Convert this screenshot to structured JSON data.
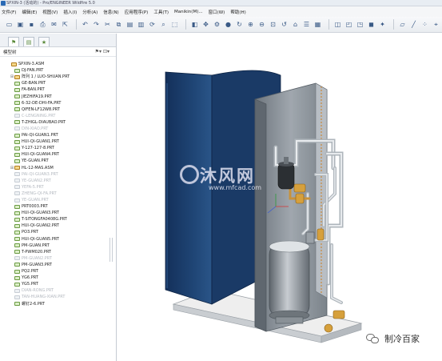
{
  "window": {
    "title": "SPXIN-3 (活动的) - Pro/ENGINEER Wildfire 5.0"
  },
  "menu": {
    "items": [
      "文件(F)",
      "编辑(E)",
      "视图(V)",
      "插入(I)",
      "分析(A)",
      "信息(N)",
      "应用程序(P)",
      "工具(T)",
      "Manikin(M)...",
      "窗口(W)",
      "帮助(H)"
    ]
  },
  "sidebar": {
    "tree_title": "模型树",
    "tree_controls": "⚑▾ ⊡▾",
    "items": [
      {
        "label": "SPXIN-3.ASM",
        "level": "root",
        "type": "asm",
        "dim": false,
        "exp": ""
      },
      {
        "label": "DJ-FAN.PRT",
        "level": "lvl1",
        "type": "prt",
        "dim": false,
        "exp": ""
      },
      {
        "label": "阵列 1 / LUO-SHUAN.PRT",
        "level": "lvl1",
        "type": "asm",
        "dim": false,
        "exp": "⊞"
      },
      {
        "label": "GE-BAN.PRT",
        "level": "lvl1",
        "type": "prt",
        "dim": false,
        "exp": ""
      },
      {
        "label": "FA-BAN.PRT",
        "level": "lvl1",
        "type": "prt",
        "dim": false,
        "exp": ""
      },
      {
        "label": "JIEZHIFA19.PRT",
        "level": "lvl1",
        "type": "prt",
        "dim": false,
        "exp": ""
      },
      {
        "label": "6-32-DE-DHI-FA.PRT",
        "level": "lvl1",
        "type": "prt",
        "dim": false,
        "exp": ""
      },
      {
        "label": "QIFEN-LF12W8.PRT",
        "level": "lvl1",
        "type": "prt",
        "dim": false,
        "exp": ""
      },
      {
        "label": "C-LENGNING.PRT",
        "level": "lvl1",
        "type": "prt",
        "dim": true,
        "exp": ""
      },
      {
        "label": "T-ZHIGL-DIAUBAO.PRT",
        "level": "lvl1",
        "type": "prt",
        "dim": false,
        "exp": ""
      },
      {
        "label": "DIN-XIAO.PRT",
        "level": "lvl1",
        "type": "prt",
        "dim": true,
        "exp": ""
      },
      {
        "label": "PAI-QI-GUAN1.PRT",
        "level": "lvl1",
        "type": "prt",
        "dim": false,
        "exp": ""
      },
      {
        "label": "HUI-QI-GUAN1.PRT",
        "level": "lvl1",
        "type": "prt",
        "dim": false,
        "exp": ""
      },
      {
        "label": "Y-127-127-8.PRT",
        "level": "lvl1",
        "type": "prt",
        "dim": false,
        "exp": ""
      },
      {
        "label": "HUI-QI-GUAN4.PRT",
        "level": "lvl1",
        "type": "prt",
        "dim": false,
        "exp": ""
      },
      {
        "label": "YE-GUAN.PRT",
        "level": "lvl1",
        "type": "prt",
        "dim": false,
        "exp": ""
      },
      {
        "label": "HL-12-MAS.ASM",
        "level": "lvl1",
        "type": "asm",
        "dim": false,
        "exp": "⊞"
      },
      {
        "label": "PAI-QI-GUAN3.PRT",
        "level": "lvl1",
        "type": "prt",
        "dim": true,
        "exp": ""
      },
      {
        "label": "YE-GUAN2.PRT",
        "level": "lvl1",
        "type": "prt",
        "dim": true,
        "exp": ""
      },
      {
        "label": "YEFA-5.PRT",
        "level": "lvl1",
        "type": "prt",
        "dim": true,
        "exp": ""
      },
      {
        "label": "ZHENG-QI-FA.PRT",
        "level": "lvl1",
        "type": "prt",
        "dim": true,
        "exp": ""
      },
      {
        "label": "YE-GUAN.PRT",
        "level": "lvl1",
        "type": "prt",
        "dim": true,
        "exp": ""
      },
      {
        "label": "PRT0003.PRT",
        "level": "lvl1",
        "type": "prt",
        "dim": false,
        "exp": ""
      },
      {
        "label": "HUI-QI-GUAN3.PRT",
        "level": "lvl1",
        "type": "prt",
        "dim": false,
        "exp": ""
      },
      {
        "label": "T-SITONGFA0408G.PRT",
        "level": "lvl1",
        "type": "prt",
        "dim": false,
        "exp": ""
      },
      {
        "label": "HUI-QI-GUAN2.PRT",
        "level": "lvl1",
        "type": "prt",
        "dim": false,
        "exp": ""
      },
      {
        "label": "PO3.PRT",
        "level": "lvl1",
        "type": "prt",
        "dim": false,
        "exp": ""
      },
      {
        "label": "HUI-QI-GUAN5.PRT",
        "level": "lvl1",
        "type": "prt",
        "dim": false,
        "exp": ""
      },
      {
        "label": "PM-GUAN.PRT",
        "level": "lvl1",
        "type": "prt",
        "dim": false,
        "exp": ""
      },
      {
        "label": "T-PWM020.PRT",
        "level": "lvl1",
        "type": "prt",
        "dim": false,
        "exp": ""
      },
      {
        "label": "PM-GUAN2.PRT",
        "level": "lvl1",
        "type": "prt",
        "dim": true,
        "exp": ""
      },
      {
        "label": "PM-GUAN3.PRT",
        "level": "lvl1",
        "type": "prt",
        "dim": false,
        "exp": ""
      },
      {
        "label": "PQ2.PRT",
        "level": "lvl1",
        "type": "prt",
        "dim": false,
        "exp": ""
      },
      {
        "label": "YG6.PRT",
        "level": "lvl1",
        "type": "prt",
        "dim": false,
        "exp": ""
      },
      {
        "label": "YG5.PRT",
        "level": "lvl1",
        "type": "prt",
        "dim": false,
        "exp": ""
      },
      {
        "label": "DIAN-RONG.PRT",
        "level": "lvl1",
        "type": "prt",
        "dim": true,
        "exp": ""
      },
      {
        "label": "TAN-HUANG-XIAN.PRT",
        "level": "lvl1",
        "type": "prt",
        "dim": true,
        "exp": ""
      },
      {
        "label": "螺钉2-6.PRT",
        "level": "lvl1",
        "type": "prt",
        "dim": false,
        "exp": ""
      }
    ]
  },
  "viewport": {
    "watermark_title": "沐风网",
    "watermark_url": "www.mfcad.com"
  },
  "badge": {
    "text": "制冷百家"
  },
  "colors": {
    "panel_blue": "#1c3d6b",
    "panel_grey": "#8b939b",
    "base_white": "#f2f2f2",
    "tree_icon_green": "#6a9a42"
  }
}
